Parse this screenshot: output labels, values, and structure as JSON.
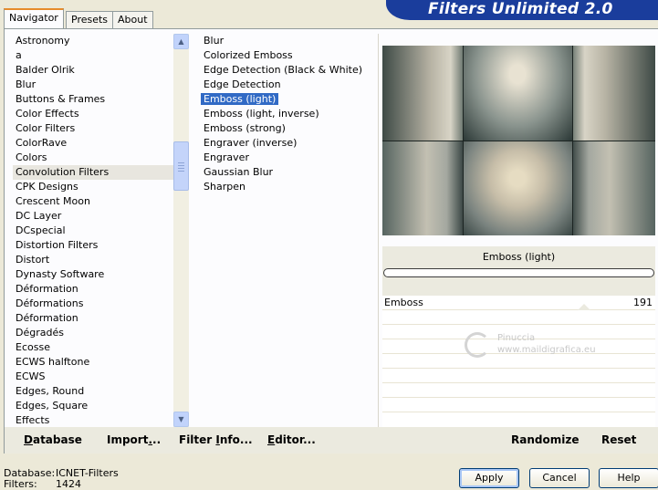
{
  "tabs": [
    {
      "label": "Navigator",
      "active": true
    },
    {
      "label": "Presets",
      "active": false
    },
    {
      "label": "About",
      "active": false
    }
  ],
  "brand": {
    "title": "Filters Unlimited 2.0",
    "color": "#1a3d9c"
  },
  "categories": {
    "items": [
      "Astronomy",
      "a",
      "Balder Olrik",
      "Blur",
      "Buttons & Frames",
      "Color Effects",
      "Color Filters",
      "ColorRave",
      "Colors",
      "Convolution Filters",
      "CPK Designs",
      "Crescent Moon",
      "DC Layer",
      "DCspecial",
      "Distortion Filters",
      "Distort",
      "Dynasty Software",
      "Déformation",
      "Déformations",
      "Déformation",
      "Dégradés",
      "Ecosse",
      "ECWS halftone",
      "ECWS",
      "Edges, Round",
      "Edges, Square",
      "Effects"
    ],
    "highlighted": "Convolution Filters"
  },
  "filters": {
    "items": [
      "Blur",
      "Colorized Emboss",
      "Edge Detection (Black & White)",
      "Edge Detection",
      "Emboss (light)",
      "Emboss (light, inverse)",
      "Emboss (strong)",
      "Engraver (inverse)",
      "Engraver",
      "Gaussian Blur",
      "Sharpen"
    ],
    "selected": "Emboss (light)"
  },
  "preview": {
    "filter_name": "Emboss (light)",
    "progress": 0
  },
  "params": [
    {
      "label": "Emboss",
      "value": "191"
    }
  ],
  "watermark": {
    "line1": "Pinuccia",
    "line2": "www.maildigrafica.eu"
  },
  "bottom_buttons": {
    "database": {
      "u": "D",
      "rest": "atabase"
    },
    "import": {
      "pre": "Import",
      "u": ".",
      "rest": ".."
    },
    "filter_info": {
      "pre": "Filter ",
      "u": "I",
      "rest": "nfo..."
    },
    "editor": {
      "u": "E",
      "rest": "ditor..."
    },
    "randomize": "Randomize",
    "reset": "Reset"
  },
  "footer": {
    "database_label": "Database:",
    "database_value": "ICNET-Filters",
    "filters_label": "Filters:",
    "filters_value": "1424",
    "apply": "Apply",
    "cancel": "Cancel",
    "help": "Help"
  },
  "colors": {
    "selection": "#316ac5",
    "tab_accent": "#e68b2c",
    "button_border": "#003c74"
  }
}
